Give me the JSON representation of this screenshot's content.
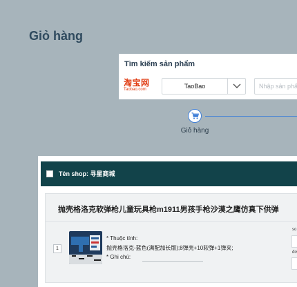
{
  "page": {
    "title": "Giỏ hàng"
  },
  "search": {
    "title": "Tìm kiếm sản phẩm",
    "logo_text": "淘宝网",
    "logo_subtext": "Taobao.com",
    "platform_value": "TaoBao",
    "placeholder": "Nhập sản phẩm"
  },
  "steps": [
    {
      "label": "Giỏ hàng",
      "icon": "cart-icon",
      "active": true
    }
  ],
  "shop": {
    "label": "Tên shop: 寻星商城",
    "items": [
      {
        "index": "1",
        "title": "抛壳格洛克软弹枪儿童玩具枪m1911男孩手枪沙漠之鹰仿真下供弹",
        "attributes_label": "* Thuộc tính:",
        "attributes_value": "抛壳格洛克-蓝色(满配加长版);8弹壳+10软弹+1弹夹;",
        "note_label": "* Ghi chú:",
        "side_label_1": "so",
        "side_label_2": "đơ"
      }
    ]
  },
  "colors": {
    "background": "#a7b4bb",
    "accent": "#3f7fd8",
    "shop_header": "#12434a",
    "logo": "#e03a10"
  }
}
